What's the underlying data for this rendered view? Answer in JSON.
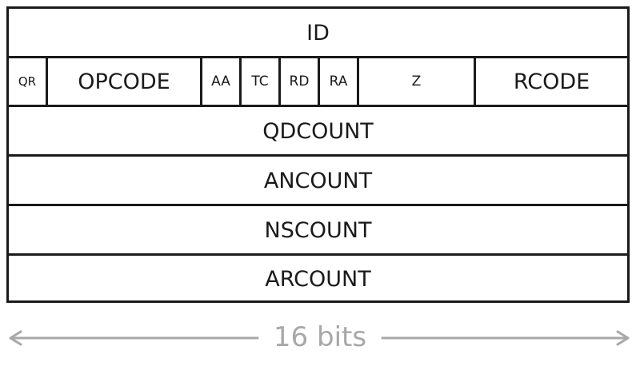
{
  "rows": {
    "id": "ID",
    "flags": {
      "qr": "QR",
      "opcode": "OPCODE",
      "aa": "AA",
      "tc": "TC",
      "rd": "RD",
      "ra": "RA",
      "z": "Z",
      "rcode": "RCODE"
    },
    "qdcount": "QDCOUNT",
    "ancount": "ANCOUNT",
    "nscount": "NSCOUNT",
    "arcount": "ARCOUNT"
  },
  "width_label": "16 bits",
  "colors": {
    "line": "#1a1a1a",
    "caption": "#a8a8a8"
  }
}
